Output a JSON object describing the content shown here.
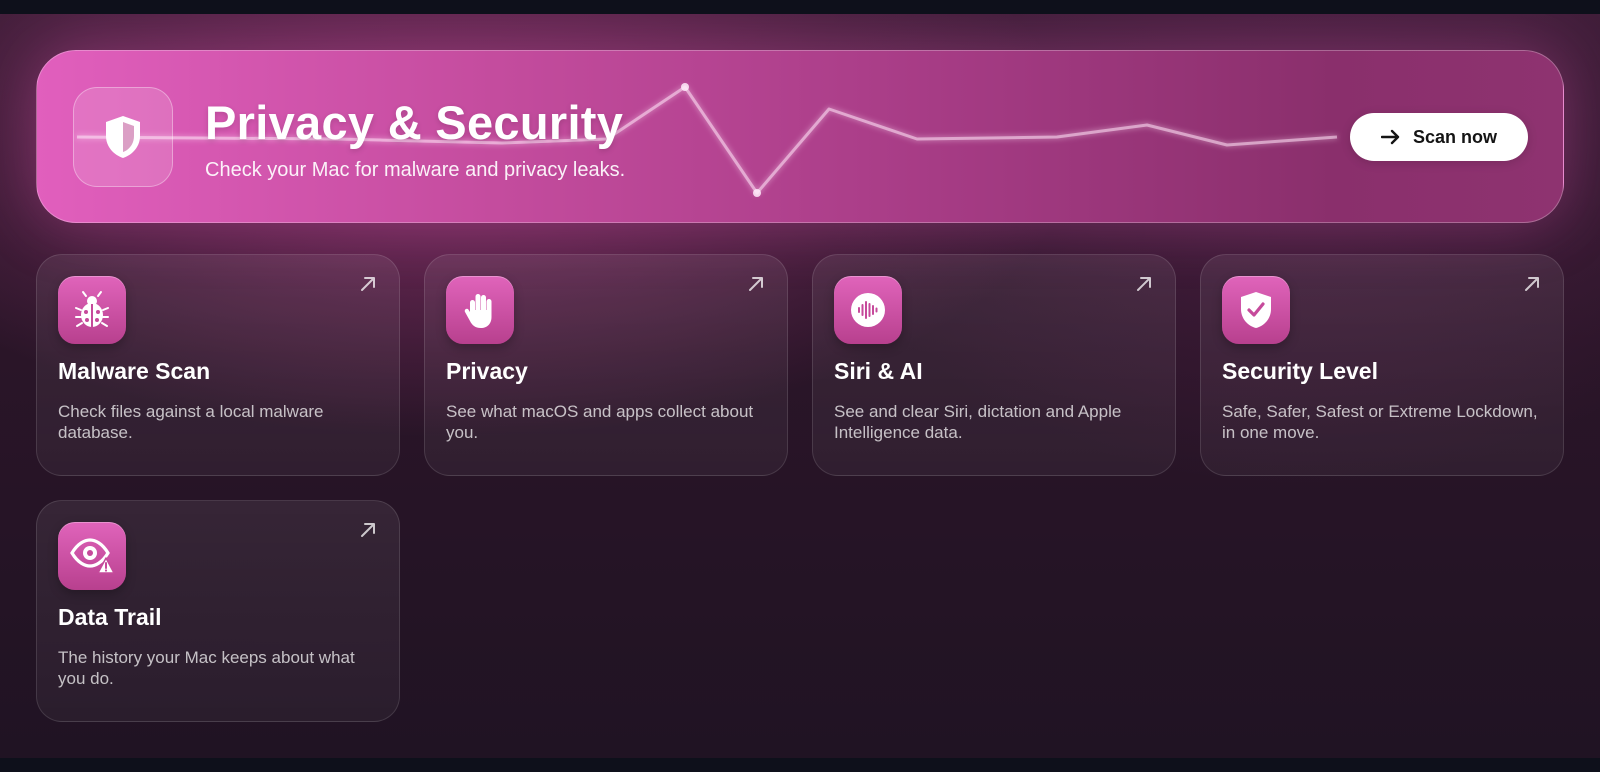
{
  "hero": {
    "title": "Privacy & Security",
    "subtitle": "Check your Mac for malware and privacy leaks.",
    "icon": "shield-half-icon",
    "scan_button_label": "Scan now",
    "scan_button_icon": "arrow-right-icon"
  },
  "cards": [
    {
      "title": "Malware Scan",
      "description": "Check files against a local malware database.",
      "icon": "ladybug-icon"
    },
    {
      "title": "Privacy",
      "description": "See what macOS and apps collect about you.",
      "icon": "raised-hand-icon"
    },
    {
      "title": "Siri & AI",
      "description": "See and clear Siri, dictation and Apple Intelligence data.",
      "icon": "siri-waveform-icon"
    },
    {
      "title": "Security Level",
      "description": "Safe, Safer, Safest or Extreme Lockdown, in one move.",
      "icon": "shield-check-icon"
    },
    {
      "title": "Data Trail",
      "description": "The history your Mac keeps about what you do.",
      "icon": "eye-warning-icon"
    }
  ],
  "colors": {
    "accent": "#d653ad",
    "background": "#241526",
    "button_bg": "#ffffff"
  }
}
